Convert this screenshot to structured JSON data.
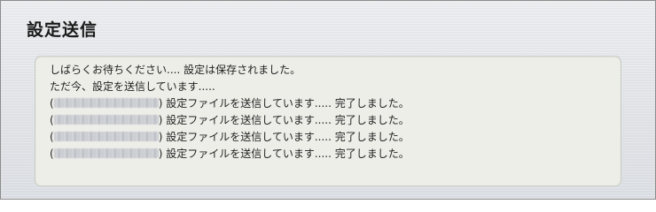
{
  "page": {
    "title": "設定送信"
  },
  "panel": {
    "status_line_1": "しばらくお待ちください.... 設定は保存されました。",
    "status_line_2": "ただ今、設定を送信しています.....",
    "devices": [
      {
        "open": "(",
        "close": ")",
        "message": " 設定ファイルを送信しています..... 完了しました。"
      },
      {
        "open": "(",
        "close": ")",
        "message": " 設定ファイルを送信しています..... 完了しました。"
      },
      {
        "open": "(",
        "close": ")",
        "message": " 設定ファイルを送信しています..... 完了しました。"
      },
      {
        "open": "(",
        "close": ")",
        "message": " 設定ファイルを送信しています..... 完了しました。"
      }
    ]
  }
}
